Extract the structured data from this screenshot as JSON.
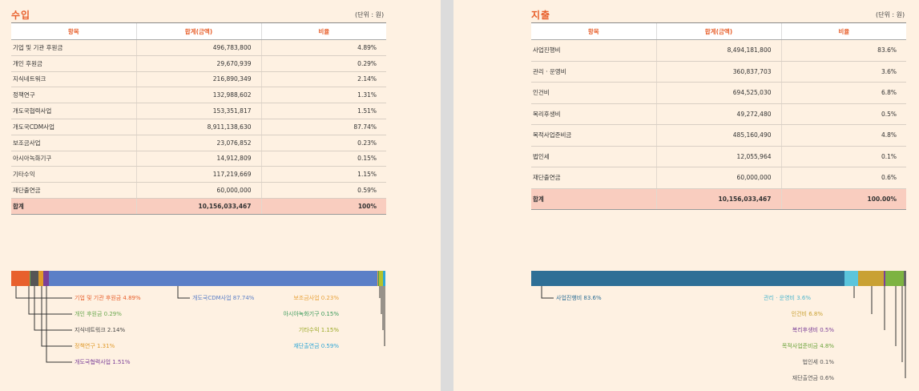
{
  "income": {
    "title": "수입",
    "unit": "(단위 : 원)",
    "headers": [
      "항목",
      "합계(금액)",
      "비율"
    ],
    "rows": [
      {
        "item": "기업 및 기관 후원금",
        "amount": "496,783,800",
        "ratio": "4.89%"
      },
      {
        "item": "개인 후원금",
        "amount": "29,670,939",
        "ratio": "0.29%"
      },
      {
        "item": "지식네트워크",
        "amount": "216,890,349",
        "ratio": "2.14%"
      },
      {
        "item": "정책연구",
        "amount": "132,988,602",
        "ratio": "1.31%"
      },
      {
        "item": "개도국협력사업",
        "amount": "153,351,817",
        "ratio": "1.51%"
      },
      {
        "item": "개도국CDM사업",
        "amount": "8,911,138,630",
        "ratio": "87.74%"
      },
      {
        "item": "보조금사업",
        "amount": "23,076,852",
        "ratio": "0.23%"
      },
      {
        "item": "아시아녹화기구",
        "amount": "14,912,809",
        "ratio": "0.15%"
      },
      {
        "item": "기타수익",
        "amount": "117,219,669",
        "ratio": "1.15%"
      },
      {
        "item": "재단출연금",
        "amount": "60,000,000",
        "ratio": "0.59%"
      }
    ],
    "total": {
      "item": "합계",
      "amount": "10,156,033,467",
      "ratio": "100%"
    },
    "bar": [
      {
        "label": "기업 및 기관 후원금 4.89%",
        "value": 4.89,
        "color": "#e8602c"
      },
      {
        "label": "개인 후원금 0.29%",
        "value": 0.29,
        "color": "#6aa84f"
      },
      {
        "label": "지식네트워크 2.14%",
        "value": 2.14,
        "color": "#555555"
      },
      {
        "label": "정책연구 1.31%",
        "value": 1.31,
        "color": "#e09a2b"
      },
      {
        "label": "개도국협력사업 1.51%",
        "value": 1.51,
        "color": "#7b3f98"
      },
      {
        "label": "개도국CDM사업 87.74%",
        "value": 87.74,
        "color": "#5b7fc7"
      },
      {
        "label": "보조금사업 0.23%",
        "value": 0.23,
        "color": "#e8a33d"
      },
      {
        "label": "아시아녹화기구 0.15%",
        "value": 0.15,
        "color": "#3a9a5a"
      },
      {
        "label": "기타수익 1.15%",
        "value": 1.15,
        "color": "#b5c22b"
      },
      {
        "label": "재단출연금 0.59%",
        "value": 0.59,
        "color": "#2fa6d6"
      }
    ]
  },
  "expense": {
    "title": "지출",
    "unit": "(단위 : 원)",
    "headers": [
      "항목",
      "합계(금액)",
      "비율"
    ],
    "rows": [
      {
        "item": "사업진행비",
        "amount": "8,494,181,800",
        "ratio": "83.6%"
      },
      {
        "item": "관리 · 운영비",
        "amount": "360,837,703",
        "ratio": "3.6%"
      },
      {
        "item": "인건비",
        "amount": "694,525,030",
        "ratio": "6.8%"
      },
      {
        "item": "복리후생비",
        "amount": "49,272,480",
        "ratio": "0.5%"
      },
      {
        "item": "목적사업준비금",
        "amount": "485,160,490",
        "ratio": "4.8%"
      },
      {
        "item": "법인세",
        "amount": "12,055,964",
        "ratio": "0.1%"
      },
      {
        "item": "재단출연금",
        "amount": "60,000,000",
        "ratio": "0.6%"
      }
    ],
    "total": {
      "item": "합계",
      "amount": "10,156,033,467",
      "ratio": "100.00%"
    },
    "bar": [
      {
        "label": "사업진행비 83.6%",
        "value": 83.6,
        "color": "#2e6f96"
      },
      {
        "label": "관리 · 운영비 3.6%",
        "value": 3.6,
        "color": "#5bc5dc"
      },
      {
        "label": "인건비 6.8%",
        "value": 6.8,
        "color": "#c9a133"
      },
      {
        "label": "복리후생비 0.5%",
        "value": 0.5,
        "color": "#7b3f98"
      },
      {
        "label": "목적사업준비금 4.8%",
        "value": 4.8,
        "color": "#7db342"
      },
      {
        "label": "법인세 0.1%",
        "value": 0.1,
        "color": "#2e6f96"
      },
      {
        "label": "재단출연금 0.6%",
        "value": 0.6,
        "color": "#666666"
      }
    ]
  }
}
